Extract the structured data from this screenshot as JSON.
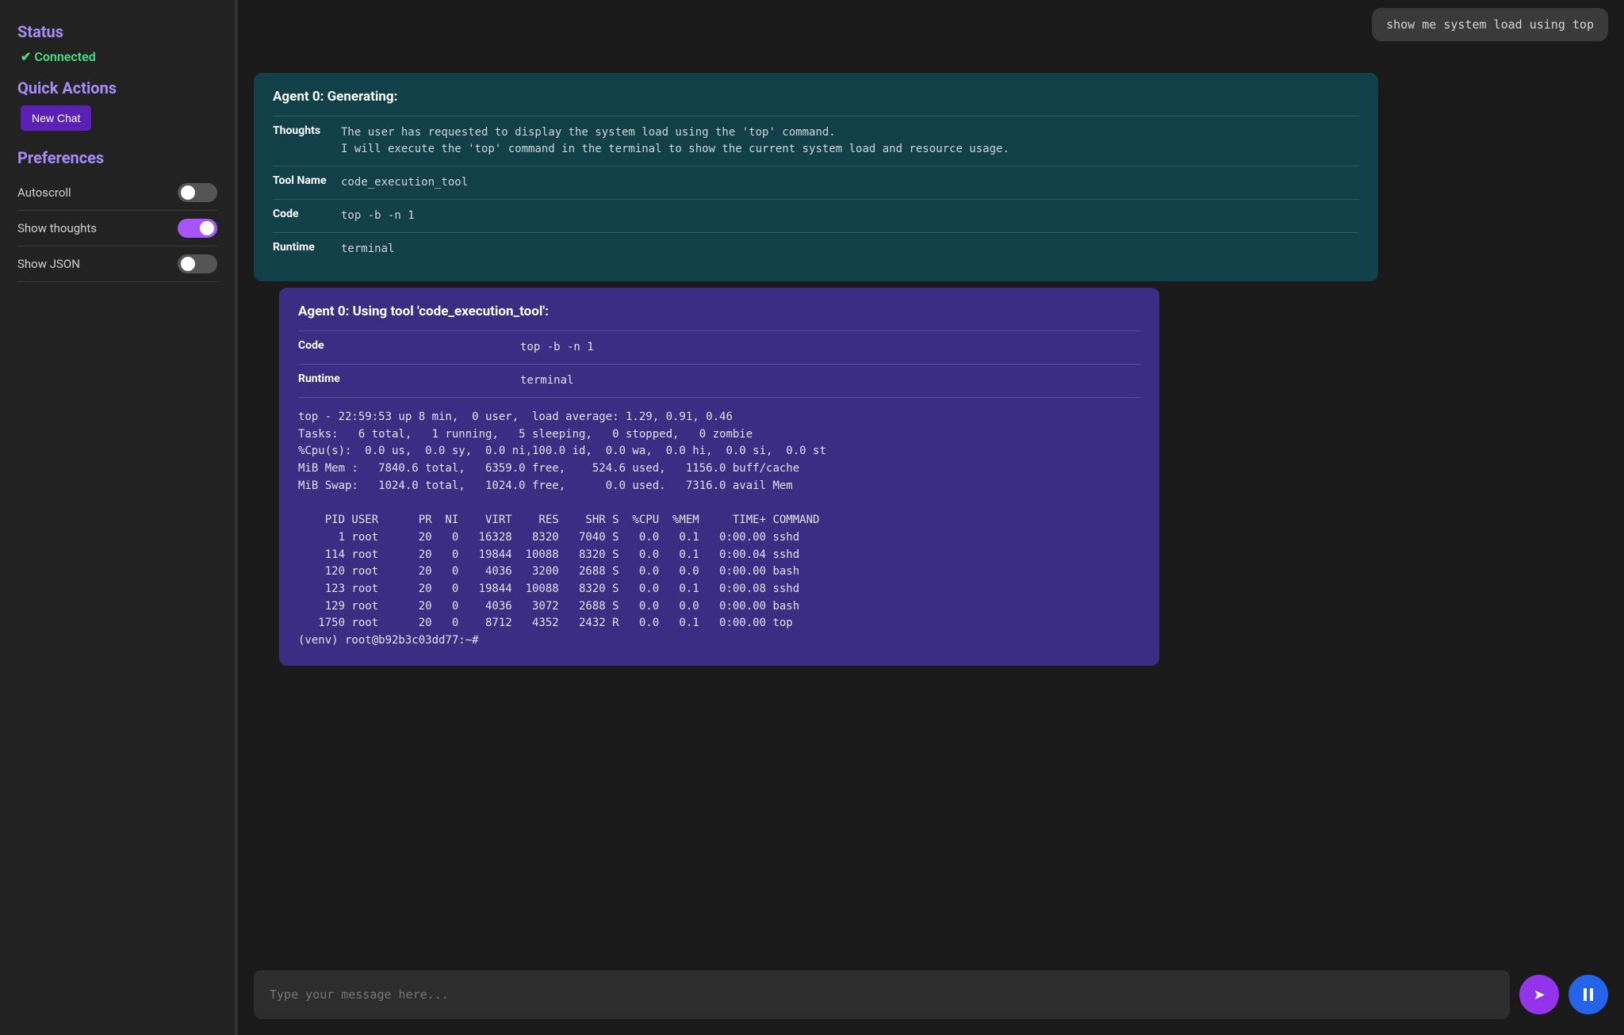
{
  "sidebar": {
    "status_heading": "Status",
    "status_text": "✔ Connected",
    "quick_heading": "Quick Actions",
    "new_chat_label": "New Chat",
    "prefs_heading": "Preferences",
    "prefs": [
      {
        "label": "Autoscroll",
        "on": false
      },
      {
        "label": "Show thoughts",
        "on": true
      },
      {
        "label": "Show JSON",
        "on": false
      }
    ]
  },
  "user_message": "show me system load using top",
  "thoughts_box": {
    "title": "Agent 0: Generating:",
    "rows": {
      "thoughts_label": "Thoughts",
      "thoughts_val": "The user has requested to display the system load using the 'top' command.\nI will execute the 'top' command in the terminal to show the current system load and resource usage.",
      "toolname_label": "Tool Name",
      "toolname_val": "code_execution_tool",
      "code_label": "Code",
      "code_val": "top -b -n 1",
      "runtime_label": "Runtime",
      "runtime_val": "terminal"
    }
  },
  "tool_box": {
    "title": "Agent 0: Using tool 'code_execution_tool':",
    "code_label": "Code",
    "code_val": "top -b -n 1",
    "runtime_label": "Runtime",
    "runtime_val": "terminal",
    "output": "top - 22:59:53 up 8 min,  0 user,  load average: 1.29, 0.91, 0.46\nTasks:   6 total,   1 running,   5 sleeping,   0 stopped,   0 zombie\n%Cpu(s):  0.0 us,  0.0 sy,  0.0 ni,100.0 id,  0.0 wa,  0.0 hi,  0.0 si,  0.0 st\nMiB Mem :   7840.6 total,   6359.0 free,    524.6 used,   1156.0 buff/cache\nMiB Swap:   1024.0 total,   1024.0 free,      0.0 used.   7316.0 avail Mem\n\n    PID USER      PR  NI    VIRT    RES    SHR S  %CPU  %MEM     TIME+ COMMAND\n      1 root      20   0   16328   8320   7040 S   0.0   0.1   0:00.00 sshd\n    114 root      20   0   19844  10088   8320 S   0.0   0.1   0:00.04 sshd\n    120 root      20   0    4036   3200   2688 S   0.0   0.0   0:00.00 bash\n    123 root      20   0   19844  10088   8320 S   0.0   0.1   0:00.08 sshd\n    129 root      20   0    4036   3072   2688 S   0.0   0.0   0:00.00 bash\n   1750 root      20   0    8712   4352   2432 R   0.0   0.1   0:00.00 top\n(venv) root@b92b3c03dd77:~#"
  },
  "input": {
    "placeholder": "Type your message here..."
  }
}
